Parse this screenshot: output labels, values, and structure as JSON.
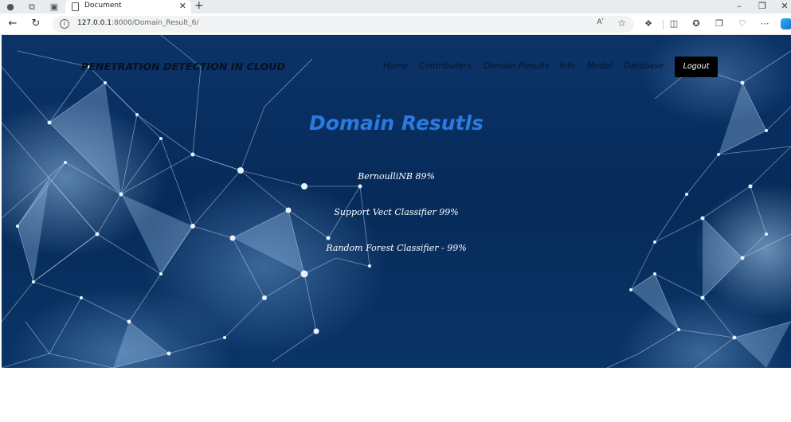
{
  "browser": {
    "tab_title": "Document",
    "url_host": "127.0.0.1",
    "url_path": ":8000/Domain_Result_6/",
    "reader_label": "Aʹ"
  },
  "site": {
    "brand": "PENETRATION DETECTION IN CLOUD",
    "nav": [
      {
        "label": "Home"
      },
      {
        "label": "Contributers"
      },
      {
        "label": "Domain Results"
      },
      {
        "label": "Info"
      },
      {
        "label": "Model"
      },
      {
        "label": "Database"
      }
    ],
    "logout_label": "Logout"
  },
  "main": {
    "heading": "Domain Resutls",
    "results": [
      "BernoulliNB 89%",
      "Support Vect Classifier 99%",
      "Random Forest Classifier - 99%"
    ]
  },
  "colors": {
    "page_bg": "#062b5a",
    "heading": "#2a7ae2",
    "logout_bg": "#000000"
  }
}
